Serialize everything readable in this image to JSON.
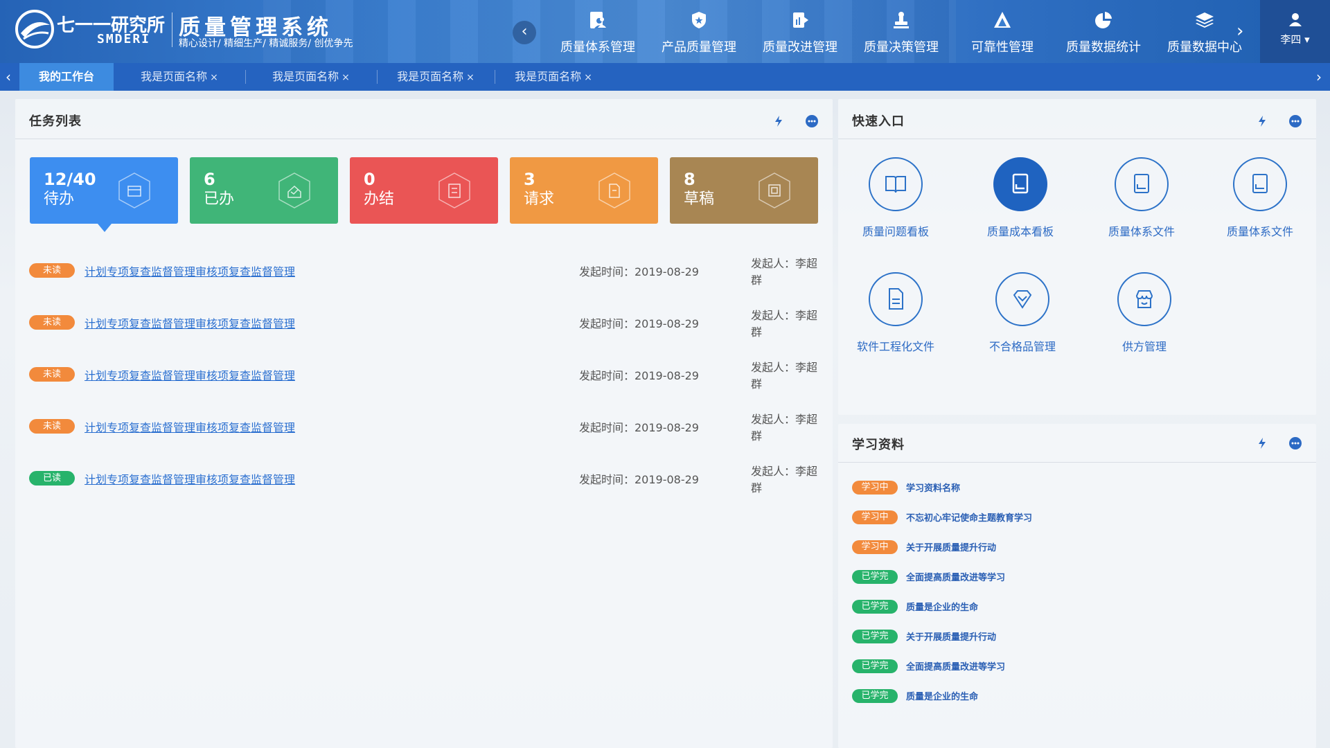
{
  "header": {
    "logo_cn": "七一一研究所",
    "logo_en": "SMDERI",
    "title": "质量管理系统",
    "slogan": "精心设计/ 精细生产/ 精诚服务/ 创优争先",
    "nav": [
      {
        "label": "质量体系管理",
        "icon": "person-doc-icon"
      },
      {
        "label": "产品质量管理",
        "icon": "shield-icon"
      },
      {
        "label": "质量改进管理",
        "icon": "report-icon"
      },
      {
        "label": "质量决策管理",
        "icon": "stamp-icon"
      },
      {
        "label": "可靠性管理",
        "icon": "triangle-icon"
      },
      {
        "label": "质量数据统计",
        "icon": "pie-icon"
      },
      {
        "label": "质量数据中心",
        "icon": "layers-icon"
      }
    ],
    "user": "李四 ▾"
  },
  "tabs": {
    "active": "我的工作台",
    "items": [
      "我是页面名称",
      "我是页面名称",
      "我是页面名称",
      "我是页面名称"
    ],
    "close": "×"
  },
  "task_panel": {
    "title": "任务列表",
    "stats": [
      {
        "num": "12/40",
        "label": "待办",
        "color": "#3d8ef0"
      },
      {
        "num": "6",
        "label": "已办",
        "color": "#40b578"
      },
      {
        "num": "0",
        "label": "办结",
        "color": "#ea5555"
      },
      {
        "num": "3",
        "label": "请求",
        "color": "#f09943"
      },
      {
        "num": "8",
        "label": "草稿",
        "color": "#a88653"
      }
    ],
    "tasks": [
      {
        "tag": "未读",
        "status": "unread",
        "title": "计划专项复查监督管理审核项复查监督管理",
        "time": "发起时间：2019-08-29",
        "user": "发起人：李超群"
      },
      {
        "tag": "未读",
        "status": "unread",
        "title": "计划专项复查监督管理审核项复查监督管理",
        "time": "发起时间：2019-08-29",
        "user": "发起人：李超群"
      },
      {
        "tag": "未读",
        "status": "unread",
        "title": "计划专项复查监督管理审核项复查监督管理",
        "time": "发起时间：2019-08-29",
        "user": "发起人：李超群"
      },
      {
        "tag": "未读",
        "status": "unread",
        "title": "计划专项复查监督管理审核项复查监督管理",
        "time": "发起时间：2019-08-29",
        "user": "发起人：李超群"
      },
      {
        "tag": "已读",
        "status": "read",
        "title": "计划专项复查监督管理审核项复查监督管理",
        "time": "发起时间：2019-08-29",
        "user": "发起人：李超群"
      }
    ]
  },
  "quick_panel": {
    "title": "快速入口",
    "items": [
      {
        "label": "质量问题看板",
        "icon": "book-icon"
      },
      {
        "label": "质量成本看板",
        "icon": "document-icon"
      },
      {
        "label": "质量体系文件",
        "icon": "document-icon"
      },
      {
        "label": "质量体系文件",
        "icon": "document-icon"
      },
      {
        "label": "软件工程化文件",
        "icon": "file-text-icon"
      },
      {
        "label": "不合格品管理",
        "icon": "diamond-icon"
      },
      {
        "label": "供方管理",
        "icon": "store-icon"
      }
    ]
  },
  "learn_panel": {
    "title": "学习资料",
    "items": [
      {
        "tag": "学习中",
        "status": "ing",
        "text": "学习资料名称"
      },
      {
        "tag": "学习中",
        "status": "ing",
        "text": "不忘初心牢记使命主题教育学习"
      },
      {
        "tag": "学习中",
        "status": "ing",
        "text": "关于开展质量提升行动"
      },
      {
        "tag": "已学完",
        "status": "done",
        "text": "全面提高质量改进等学习"
      },
      {
        "tag": "已学完",
        "status": "done",
        "text": "质量是企业的生命"
      },
      {
        "tag": "已学完",
        "status": "done",
        "text": "关于开展质量提升行动"
      },
      {
        "tag": "已学完",
        "status": "done",
        "text": "全面提高质量改进等学习"
      },
      {
        "tag": "已学完",
        "status": "done",
        "text": "质量是企业的生命"
      }
    ]
  }
}
